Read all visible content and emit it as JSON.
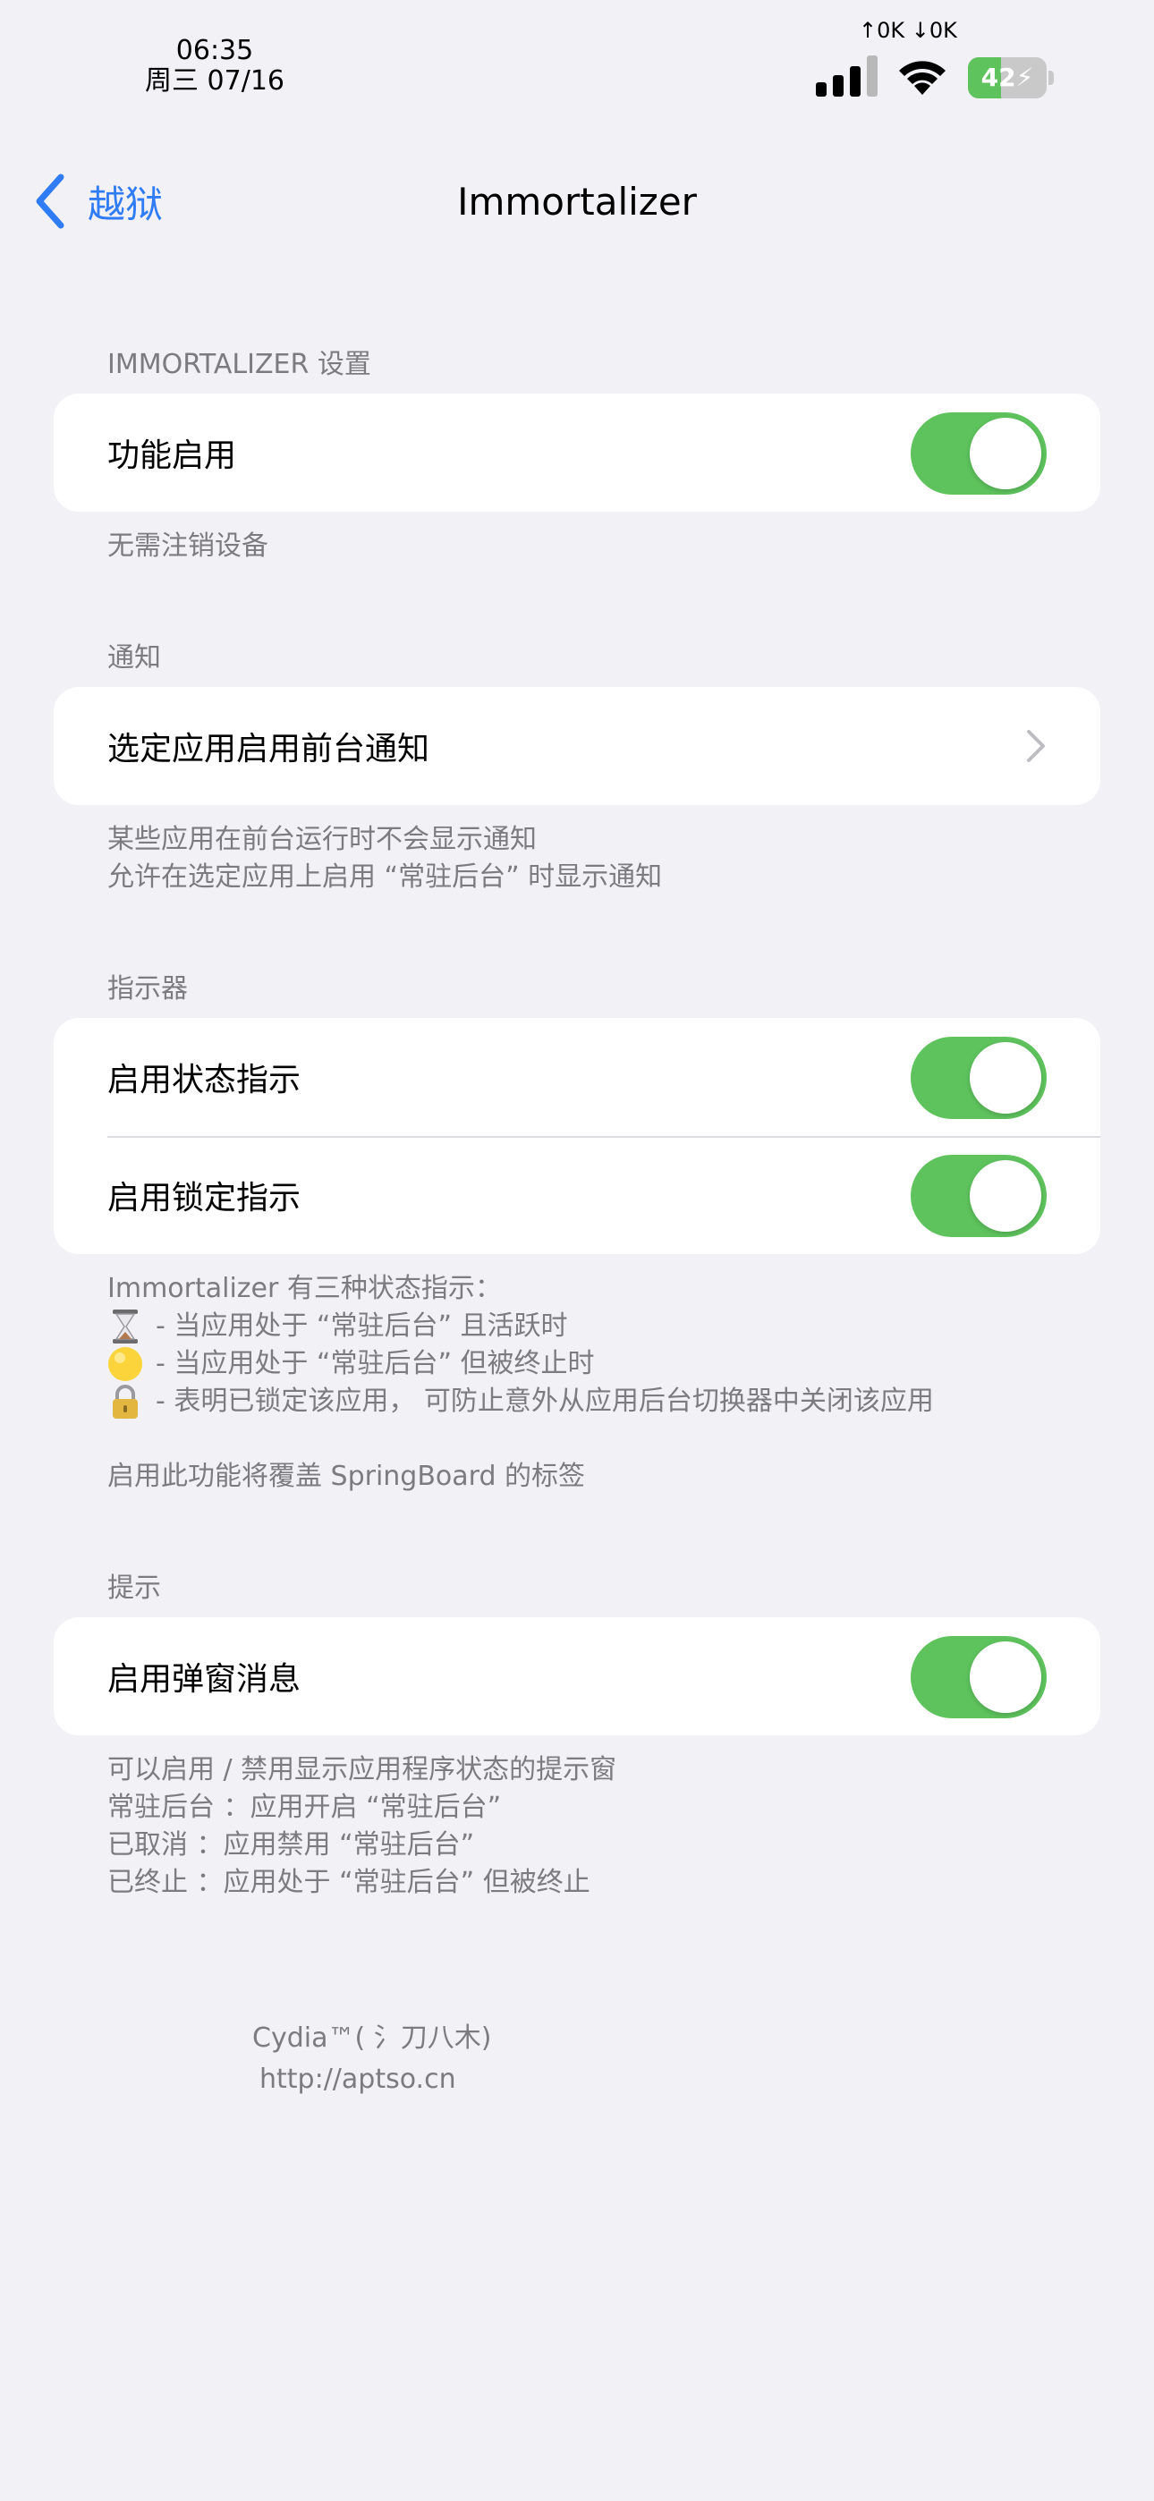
{
  "status": {
    "time": "06:35",
    "date": "周三 07/16",
    "net_speed": "↑0K ↓0K",
    "battery": "42",
    "battery_level_percent": 42
  },
  "nav": {
    "back_label": "越狱",
    "title": "Immortalizer"
  },
  "settings_section": {
    "header": "IMMORTALIZER 设置",
    "row_label": "功能启用",
    "toggle_on": true,
    "footer": "无需注销设备"
  },
  "notify_section": {
    "header": "通知",
    "row_label": "选定应用启用前台通知",
    "footer_line1": "某些应用在前台运行时不会显示通知",
    "footer_line2": "允许在选定应用上启用 “常驻后台” 时显示通知"
  },
  "indicator_section": {
    "header": "指示器",
    "row1_label": "启用状态指示",
    "row2_label": "启用锁定指示",
    "footer_intro": "Immortalizer 有三种状态指示：",
    "line1": "- 当应用处于 “常驻后台” 且活跃时",
    "line2": "- 当应用处于 “常驻后台” 但被终止时",
    "line3": "- 表明已锁定该应用， 可防止意外从应用后台切换器中关闭该应用",
    "footer_note": "启用此功能将覆盖 SpringBoard 的标签",
    "icons": [
      "hourglass-icon",
      "yellow-circle-icon",
      "padlock-icon"
    ]
  },
  "tips_section": {
    "header": "提示",
    "row_label": "启用弹窗消息",
    "footer_line1": "可以启用 / 禁用显示应用程序状态的提示窗",
    "footer_line2": "常驻后台 ：应用开启 “常驻后台”",
    "footer_line3": "已取消 ：应用禁用 “常驻后台”",
    "footer_line4": "已终止 ：应用处于 “常驻后台” 但被终止"
  },
  "credits": {
    "line1": "Cydia™( 氵刀八木)",
    "line2": "http://aptso.cn"
  },
  "colors": {
    "background": "#f2f1f6",
    "accent": "#2f7cf6",
    "toggle_on": "#5ec35d",
    "secondary_text": "#7b7b80"
  }
}
